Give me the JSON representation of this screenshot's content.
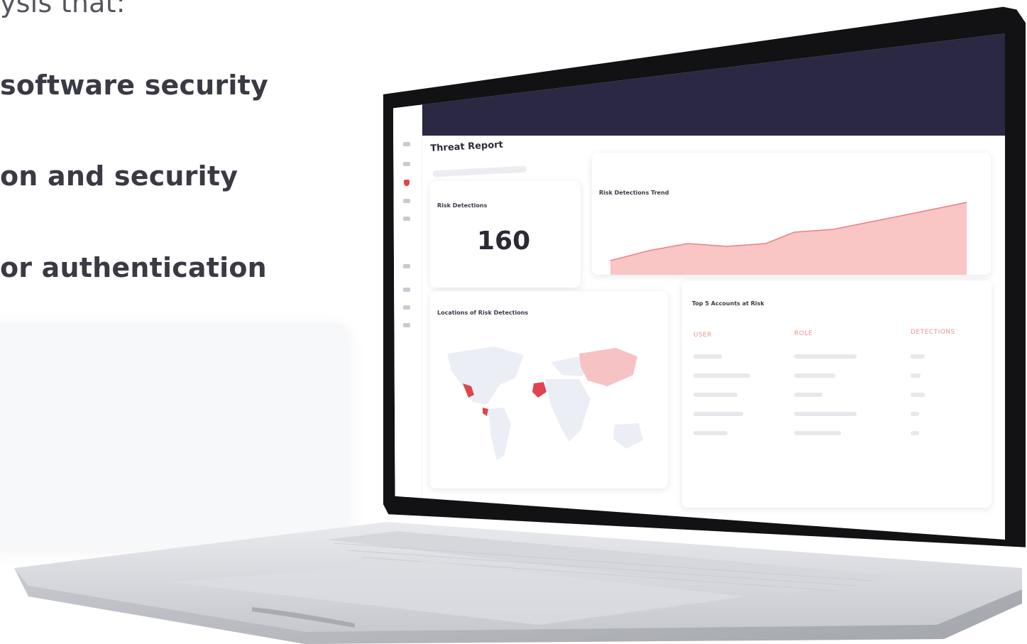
{
  "copy": {
    "line0": "ysis that:",
    "line1": "software security",
    "line2": "on and security",
    "line3": "or authentication"
  },
  "dashboard": {
    "title": "Threat Report",
    "risk_card": {
      "label": "Risk Detections",
      "value": "160"
    },
    "trend_card": {
      "label": "Risk Detections Trend"
    },
    "map_card": {
      "label": "Locations of Risk Detections"
    },
    "top_card": {
      "label": "Top 5 Accounts at Risk",
      "columns": [
        "USER",
        "ROLE",
        "DETECTIONS"
      ]
    }
  },
  "colors": {
    "topbar": "#2a2842",
    "accent": "#e0454f",
    "trend_fill": "#f7b7b7",
    "trend_line": "#ee7f84"
  }
}
